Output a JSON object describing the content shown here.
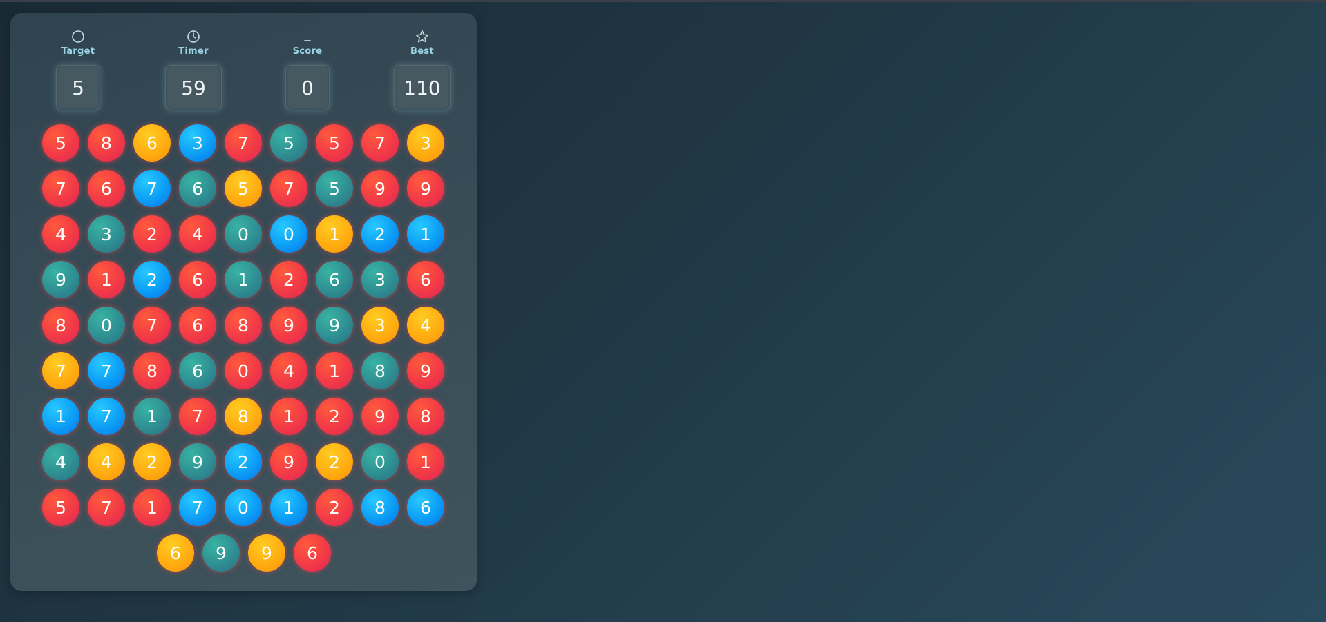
{
  "header": {
    "target": {
      "label": "Target",
      "value": "5",
      "icon": "circle-icon"
    },
    "timer": {
      "label": "Timer",
      "value": "59",
      "icon": "clock-icon"
    },
    "score": {
      "label": "Score",
      "value": "0",
      "icon": "dash-icon"
    },
    "best": {
      "label": "Best",
      "value": "110",
      "icon": "star-icon"
    }
  },
  "colors": {
    "red": "#f23a47",
    "orange": "#ffaa10",
    "teal": "#2f8e92",
    "blue": "#0c9df5",
    "label": "#9bd3e6"
  },
  "grid": [
    [
      {
        "n": "5",
        "c": "red"
      },
      {
        "n": "8",
        "c": "red"
      },
      {
        "n": "6",
        "c": "orange"
      },
      {
        "n": "3",
        "c": "blue"
      },
      {
        "n": "7",
        "c": "red"
      },
      {
        "n": "5",
        "c": "teal"
      },
      {
        "n": "5",
        "c": "red"
      },
      {
        "n": "7",
        "c": "red"
      },
      {
        "n": "3",
        "c": "orange"
      }
    ],
    [
      {
        "n": "7",
        "c": "red"
      },
      {
        "n": "6",
        "c": "red"
      },
      {
        "n": "7",
        "c": "blue"
      },
      {
        "n": "6",
        "c": "teal"
      },
      {
        "n": "5",
        "c": "orange"
      },
      {
        "n": "7",
        "c": "red"
      },
      {
        "n": "5",
        "c": "teal"
      },
      {
        "n": "9",
        "c": "red"
      },
      {
        "n": "9",
        "c": "red"
      }
    ],
    [
      {
        "n": "4",
        "c": "red"
      },
      {
        "n": "3",
        "c": "teal"
      },
      {
        "n": "2",
        "c": "red"
      },
      {
        "n": "4",
        "c": "red"
      },
      {
        "n": "0",
        "c": "teal"
      },
      {
        "n": "0",
        "c": "blue"
      },
      {
        "n": "1",
        "c": "orange"
      },
      {
        "n": "2",
        "c": "blue"
      },
      {
        "n": "1",
        "c": "blue"
      }
    ],
    [
      {
        "n": "9",
        "c": "teal"
      },
      {
        "n": "1",
        "c": "red"
      },
      {
        "n": "2",
        "c": "blue"
      },
      {
        "n": "6",
        "c": "red"
      },
      {
        "n": "1",
        "c": "teal"
      },
      {
        "n": "2",
        "c": "red"
      },
      {
        "n": "6",
        "c": "teal"
      },
      {
        "n": "3",
        "c": "teal"
      },
      {
        "n": "6",
        "c": "red"
      }
    ],
    [
      {
        "n": "8",
        "c": "red"
      },
      {
        "n": "0",
        "c": "teal"
      },
      {
        "n": "7",
        "c": "red"
      },
      {
        "n": "6",
        "c": "red"
      },
      {
        "n": "8",
        "c": "red"
      },
      {
        "n": "9",
        "c": "red"
      },
      {
        "n": "9",
        "c": "teal"
      },
      {
        "n": "3",
        "c": "orange"
      },
      {
        "n": "4",
        "c": "orange"
      }
    ],
    [
      {
        "n": "7",
        "c": "orange"
      },
      {
        "n": "7",
        "c": "blue"
      },
      {
        "n": "8",
        "c": "red"
      },
      {
        "n": "6",
        "c": "teal"
      },
      {
        "n": "0",
        "c": "red"
      },
      {
        "n": "4",
        "c": "red"
      },
      {
        "n": "1",
        "c": "red"
      },
      {
        "n": "8",
        "c": "teal"
      },
      {
        "n": "9",
        "c": "red"
      }
    ],
    [
      {
        "n": "1",
        "c": "blue"
      },
      {
        "n": "7",
        "c": "blue"
      },
      {
        "n": "1",
        "c": "teal"
      },
      {
        "n": "7",
        "c": "red"
      },
      {
        "n": "8",
        "c": "orange"
      },
      {
        "n": "1",
        "c": "red"
      },
      {
        "n": "2",
        "c": "red"
      },
      {
        "n": "9",
        "c": "red"
      },
      {
        "n": "8",
        "c": "red"
      }
    ],
    [
      {
        "n": "4",
        "c": "teal"
      },
      {
        "n": "4",
        "c": "orange"
      },
      {
        "n": "2",
        "c": "orange"
      },
      {
        "n": "9",
        "c": "teal"
      },
      {
        "n": "2",
        "c": "blue"
      },
      {
        "n": "9",
        "c": "red"
      },
      {
        "n": "2",
        "c": "orange"
      },
      {
        "n": "0",
        "c": "teal"
      },
      {
        "n": "1",
        "c": "red"
      }
    ],
    [
      {
        "n": "5",
        "c": "red"
      },
      {
        "n": "7",
        "c": "red"
      },
      {
        "n": "1",
        "c": "red"
      },
      {
        "n": "7",
        "c": "blue"
      },
      {
        "n": "0",
        "c": "blue"
      },
      {
        "n": "1",
        "c": "blue"
      },
      {
        "n": "2",
        "c": "red"
      },
      {
        "n": "8",
        "c": "blue"
      },
      {
        "n": "6",
        "c": "blue"
      }
    ]
  ],
  "extra_row": [
    {
      "n": "6",
      "c": "orange"
    },
    {
      "n": "9",
      "c": "teal"
    },
    {
      "n": "9",
      "c": "orange"
    },
    {
      "n": "6",
      "c": "red"
    }
  ]
}
